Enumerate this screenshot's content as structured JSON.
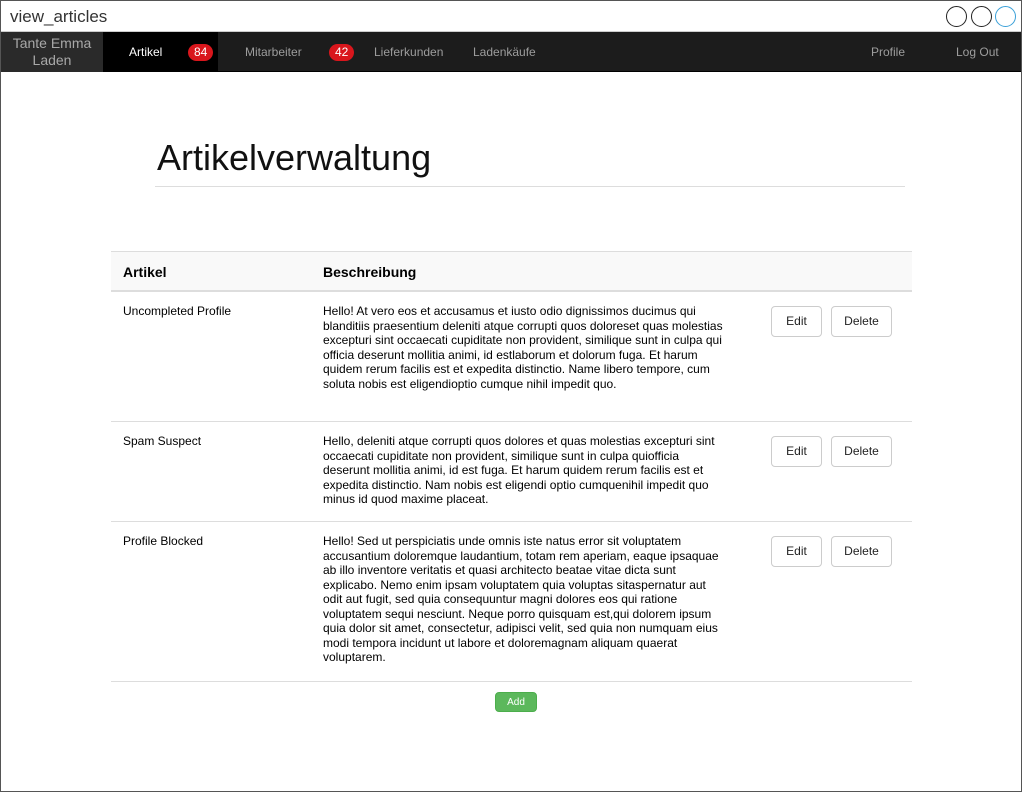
{
  "window": {
    "title": "view_articles"
  },
  "navbar": {
    "brand": "Tante Emma Laden",
    "items": [
      {
        "label": "Artikel",
        "badge": "84",
        "active": true
      },
      {
        "label": "Mitarbeiter",
        "badge": "42",
        "active": false
      },
      {
        "label": "Lieferkunden",
        "active": false
      },
      {
        "label": "Ladenkäufe",
        "active": false
      }
    ],
    "right": [
      {
        "label": "Profile"
      },
      {
        "label": "Log Out"
      }
    ],
    "colors": {
      "background": "#1c1c1c",
      "active": "#000000",
      "badge": "#d9161c"
    }
  },
  "main": {
    "title": "Artikelverwaltung",
    "table": {
      "headers": [
        "Artikel",
        "Beschreibung"
      ],
      "rows": [
        {
          "name": "Uncompleted Profile",
          "description": "Hello! At vero eos et accusamus et iusto odio dignissimos ducimus qui blanditiis praesentium deleniti atque corrupti quos doloreset quas molestias excepturi sint occaecati cupiditate non provident, similique sunt in culpa qui officia deserunt mollitia animi, id estlaborum et dolorum fuga. Et harum quidem rerum facilis est et expedita distinctio. Name libero tempore, cum soluta nobis est eligendioptio cumque nihil impedit quo.",
          "edit_label": "Edit",
          "delete_label": "Delete"
        },
        {
          "name": "Spam Suspect",
          "description": "Hello, deleniti atque corrupti quos dolores et quas molestias excepturi sint occaecati cupiditate non provident, similique sunt in culpa quiofficia deserunt mollitia animi, id est fuga. Et harum quidem rerum facilis est et expedita distinctio. Nam nobis est eligendi optio cumquenihil impedit quo minus id quod maxime placeat.",
          "edit_label": "Edit",
          "delete_label": "Delete"
        },
        {
          "name": "Profile Blocked",
          "description": "Hello! Sed ut perspiciatis unde omnis iste natus error sit voluptatem accusantium doloremque laudantium, totam rem aperiam, eaque ipsaquae ab illo inventore veritatis et quasi architecto beatae vitae dicta sunt explicabo. Nemo enim ipsam voluptatem quia voluptas sitaspernatur aut odit aut fugit, sed quia consequuntur magni dolores eos qui ratione voluptatem sequi nesciunt. Neque porro quisquam est,qui dolorem ipsum quia dolor sit amet, consectetur, adipisci velit, sed quia non numquam eius modi tempora incidunt ut labore et doloremagnam aliquam quaerat voluptarem.",
          "edit_label": "Edit",
          "delete_label": "Delete"
        }
      ]
    },
    "add_label": "Add",
    "add_color": "#5cb85c"
  }
}
